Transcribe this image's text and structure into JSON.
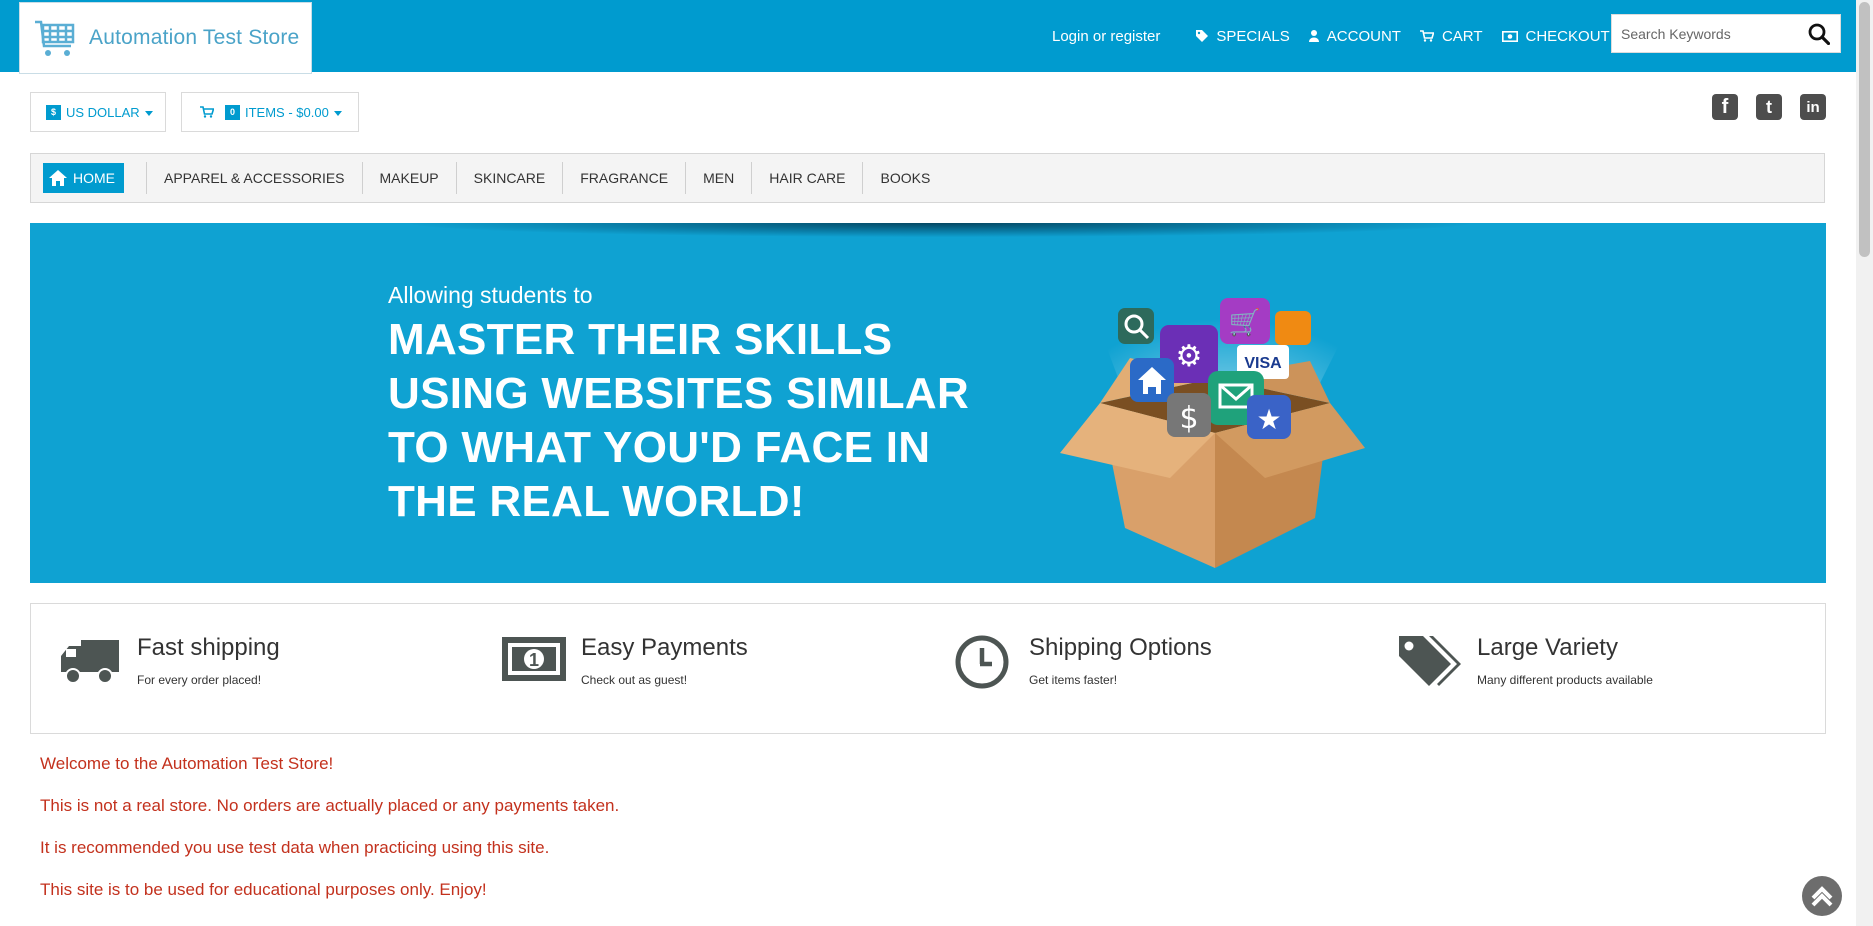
{
  "header": {
    "logo_text": "Automation Test Store",
    "login_link": "Login or register",
    "links": [
      {
        "label": "SPECIALS",
        "icon": "tag-icon"
      },
      {
        "label": "ACCOUNT",
        "icon": "user-icon"
      },
      {
        "label": "CART",
        "icon": "cart-icon"
      },
      {
        "label": "CHECKOUT",
        "icon": "money-icon"
      }
    ],
    "search": {
      "placeholder": "Search Keywords",
      "value": ""
    }
  },
  "toolbar": {
    "currency_badge": "$",
    "currency_label": "US DOLLAR",
    "cart_count": "0",
    "cart_label": "ITEMS - $0.00"
  },
  "social": [
    {
      "name": "facebook-icon",
      "glyph": "f"
    },
    {
      "name": "twitter-icon",
      "glyph": "t"
    },
    {
      "name": "linkedin-icon",
      "glyph": "in"
    }
  ],
  "nav": {
    "home_label": "HOME",
    "categories": [
      "APPAREL & ACCESSORIES",
      "MAKEUP",
      "SKINCARE",
      "FRAGRANCE",
      "MEN",
      "HAIR CARE",
      "BOOKS"
    ]
  },
  "banner": {
    "small": "Allowing students to",
    "line1": "MASTER THEIR SKILLS",
    "line2": "USING WEBSITES SIMILAR",
    "line3": "TO WHAT YOU'D FACE IN",
    "line4": "THE REAL WORLD!"
  },
  "features": [
    {
      "title": "Fast shipping",
      "subtitle": "For every order placed!",
      "icon": "truck-icon"
    },
    {
      "title": "Easy Payments",
      "subtitle": "Check out as guest!",
      "icon": "money-bill-icon"
    },
    {
      "title": "Shipping Options",
      "subtitle": "Get items faster!",
      "icon": "clock-icon"
    },
    {
      "title": "Large Variety",
      "subtitle": "Many different products available",
      "icon": "tags-icon"
    }
  ],
  "welcome": [
    "Welcome to the Automation Test Store!",
    "This is not a real store. No orders are actually placed or any payments taken.",
    "It is recommended you use test data when practicing using this site.",
    "This site is to be used for educational purposes only. Enjoy!"
  ],
  "colors": {
    "brand": "#009bcf",
    "welcome_text": "#c3311d",
    "icon_dark": "#4d4d4d"
  }
}
